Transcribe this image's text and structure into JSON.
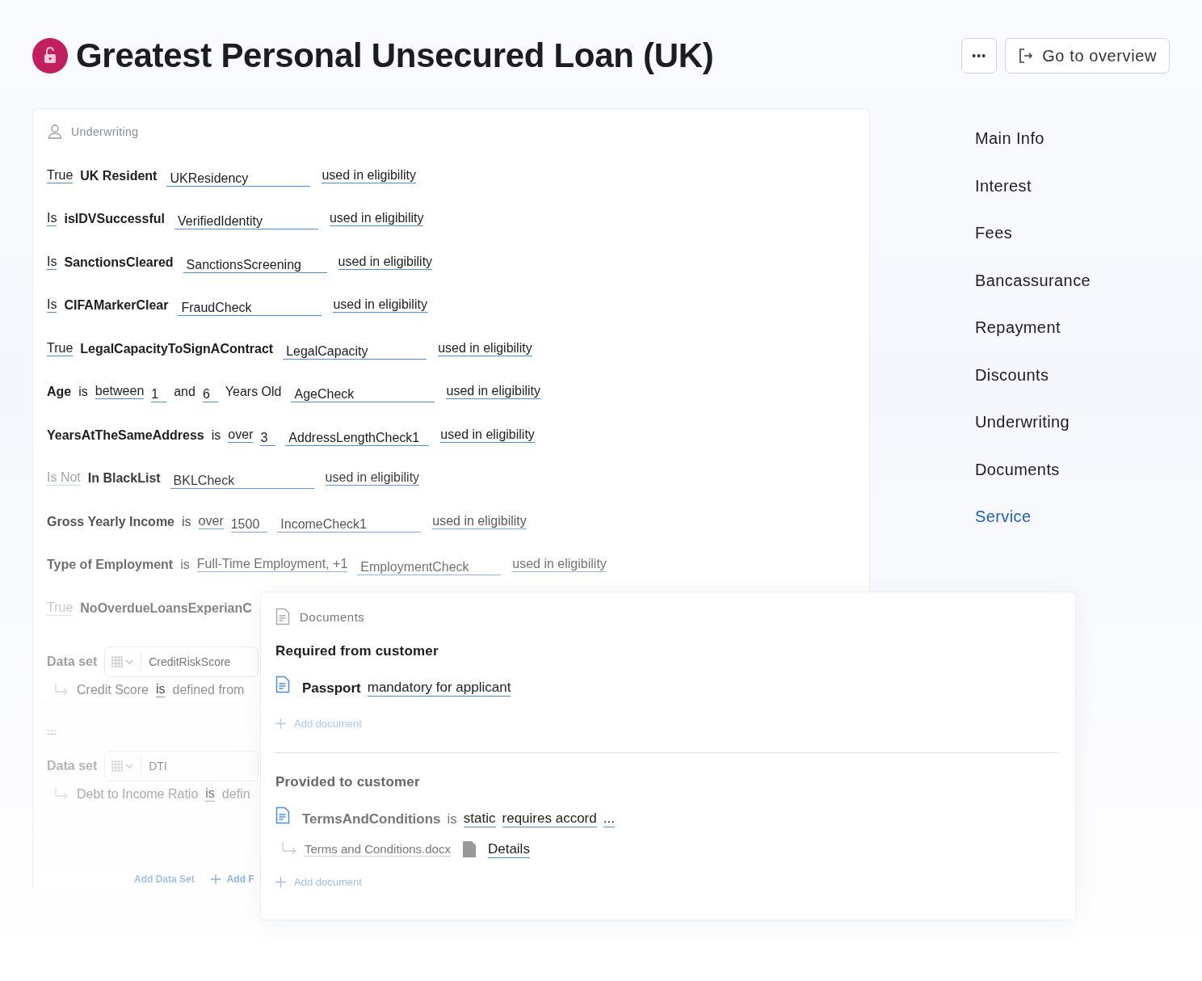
{
  "header": {
    "title": "Greatest Personal Unsecured Loan (UK)",
    "more_button": "•••",
    "overview_button": "Go to overview"
  },
  "underwriting": {
    "title": "Underwriting",
    "rules": [
      {
        "tokens": [
          {
            "kind": "keyword",
            "text": "True"
          },
          {
            "kind": "name",
            "text": "UK Resident"
          },
          {
            "kind": "field",
            "text": "UKResidency"
          },
          {
            "kind": "link",
            "text": "used in eligibility"
          }
        ]
      },
      {
        "tokens": [
          {
            "kind": "keyword",
            "text": "Is"
          },
          {
            "kind": "name",
            "text": "isIDVSuccessful"
          },
          {
            "kind": "field",
            "text": "VerifiedIdentity"
          },
          {
            "kind": "link",
            "text": "used in eligibility"
          }
        ]
      },
      {
        "tokens": [
          {
            "kind": "keyword",
            "text": "Is"
          },
          {
            "kind": "name",
            "text": "SanctionsCleared"
          },
          {
            "kind": "field",
            "text": "SanctionsScreening"
          },
          {
            "kind": "link",
            "text": "used in eligibility"
          }
        ]
      },
      {
        "tokens": [
          {
            "kind": "keyword",
            "text": "Is"
          },
          {
            "kind": "name",
            "text": "CIFAMarkerClear"
          },
          {
            "kind": "field",
            "text": "FraudCheck"
          },
          {
            "kind": "link",
            "text": "used in eligibility"
          }
        ]
      },
      {
        "tokens": [
          {
            "kind": "keyword",
            "text": "True"
          },
          {
            "kind": "name",
            "text": "LegalCapacityToSignAContract"
          },
          {
            "kind": "field",
            "text": "LegalCapacity"
          },
          {
            "kind": "link",
            "text": "used in eligibility"
          }
        ]
      },
      {
        "tokens": [
          {
            "kind": "name",
            "text": "Age"
          },
          {
            "kind": "word",
            "text": "is"
          },
          {
            "kind": "keyword",
            "text": "between"
          },
          {
            "kind": "value",
            "text": "1"
          },
          {
            "kind": "word",
            "text": "and"
          },
          {
            "kind": "value",
            "text": "6"
          },
          {
            "kind": "word",
            "text": "Years Old"
          },
          {
            "kind": "field",
            "text": "AgeCheck"
          },
          {
            "kind": "link",
            "text": "used in eligibility"
          }
        ]
      },
      {
        "tokens": [
          {
            "kind": "name",
            "text": "YearsAtTheSameAddress"
          },
          {
            "kind": "word",
            "text": "is"
          },
          {
            "kind": "keyword",
            "text": "over"
          },
          {
            "kind": "value",
            "text": "3"
          },
          {
            "kind": "field",
            "text": "AddressLengthCheck1"
          },
          {
            "kind": "link",
            "text": "used in eligibility"
          }
        ]
      },
      {
        "tokens": [
          {
            "kind": "keyword",
            "text": "Is Not"
          },
          {
            "kind": "name",
            "text": "In BlackList"
          },
          {
            "kind": "field",
            "text": "BKLCheck"
          },
          {
            "kind": "link",
            "text": "used in eligibility"
          }
        ]
      },
      {
        "tokens": [
          {
            "kind": "name",
            "text": "Gross Yearly Income"
          },
          {
            "kind": "word",
            "text": "is"
          },
          {
            "kind": "keyword",
            "text": "over"
          },
          {
            "kind": "value",
            "text": "1500"
          },
          {
            "kind": "field",
            "text": "IncomeCheck1"
          },
          {
            "kind": "link",
            "text": "used in eligibility"
          }
        ]
      },
      {
        "tokens": [
          {
            "kind": "name",
            "text": "Type of Employment"
          },
          {
            "kind": "word",
            "text": "is"
          },
          {
            "kind": "keyword",
            "text": "Full-Time Employment, +1"
          },
          {
            "kind": "field",
            "text": "EmploymentCheck"
          },
          {
            "kind": "link",
            "text": "used in eligibility"
          }
        ]
      },
      {
        "tokens": [
          {
            "kind": "keyword",
            "text": "True"
          },
          {
            "kind": "name",
            "text": "NoOverdueLoansExperianC"
          }
        ]
      }
    ],
    "datasets": [
      {
        "label": "Data set",
        "value": "CreditRiskScore",
        "tokens": [
          {
            "kind": "word",
            "text": "Credit Score"
          },
          {
            "kind": "keyword",
            "text": "is"
          },
          {
            "kind": "word",
            "text": "defined from"
          }
        ]
      },
      {
        "label": "Data set",
        "value": "DTI",
        "tokens": [
          {
            "kind": "word",
            "text": "Debt to Income Ratio"
          },
          {
            "kind": "keyword",
            "text": "is"
          },
          {
            "kind": "word",
            "text": "defin"
          }
        ]
      }
    ],
    "ellipsis": "...",
    "footer": [
      "Add Data Set",
      "Add F"
    ]
  },
  "nav": [
    {
      "label": "Main Info",
      "selected": false
    },
    {
      "label": "Interest",
      "selected": false
    },
    {
      "label": "Fees",
      "selected": false
    },
    {
      "label": "Bancassurance",
      "selected": false
    },
    {
      "label": "Repayment",
      "selected": false
    },
    {
      "label": "Discounts",
      "selected": false
    },
    {
      "label": "Underwriting",
      "selected": false
    },
    {
      "label": "Documents",
      "selected": false
    },
    {
      "label": "Service",
      "selected": true
    }
  ],
  "documents": {
    "title": "Documents",
    "sections": [
      {
        "title": "Required from customer",
        "items": [
          {
            "tokens": [
              {
                "kind": "name",
                "text": "Passport"
              },
              {
                "kind": "link",
                "text": "mandatory for applicant"
              }
            ]
          }
        ],
        "add": "Add document"
      },
      {
        "title": "Provided to customer",
        "items": [
          {
            "tokens": [
              {
                "kind": "name",
                "text": "TermsAndConditions"
              },
              {
                "kind": "word",
                "text": "is"
              },
              {
                "kind": "link",
                "text": "static"
              },
              {
                "kind": "link",
                "text": "requires accord"
              },
              {
                "kind": "link",
                "text": "..."
              }
            ],
            "file": "Terms and Conditions.docx",
            "details": "Details"
          }
        ],
        "add": "Add document"
      }
    ]
  }
}
